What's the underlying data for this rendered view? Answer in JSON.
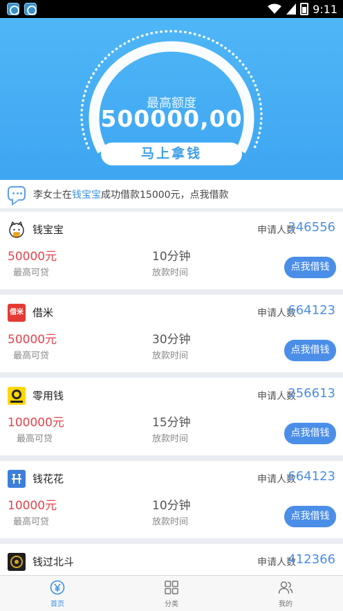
{
  "status_bar": {
    "time": "9:11",
    "app_icons": [
      "app-icon",
      "app-icon"
    ],
    "icons": [
      "wifi-icon",
      "signal-icon",
      "battery-icon"
    ]
  },
  "hero": {
    "label": "最高额度",
    "amount": "500000,00",
    "button": "马上拿钱",
    "gauge_icon": "dotted-arc"
  },
  "notice": {
    "icon": "chat-bubble-icon",
    "prefix": "李女士在",
    "highlight": "钱宝宝",
    "suffix": "成功借款15000元，点我借款"
  },
  "colors": {
    "accent": "#4a8ee8",
    "amount_red": "#e8424b",
    "hero_blue": "#3ea6f2"
  },
  "products": [
    {
      "name": "钱宝宝",
      "logo_icon": "cat-logo-icon",
      "apply_label": "申请人数",
      "apply_count": "346556",
      "amount": "50000元",
      "amount_label": "最高可贷",
      "time": "10分钟",
      "time_label": "放款时间",
      "button": "点我借钱"
    },
    {
      "name": "借米",
      "logo_icon": "jiemi-logo-icon",
      "logo_text": "借米",
      "apply_label": "申请人数",
      "apply_count": "664123",
      "amount": "50000元",
      "amount_label": "最高可贷",
      "time": "30分钟",
      "time_label": "放款时间",
      "button": "点我借钱"
    },
    {
      "name": "零用钱",
      "logo_icon": "lingyongqian-logo-icon",
      "apply_label": "申请人数",
      "apply_count": "256613",
      "amount": "100000元",
      "amount_label": "最高可贷",
      "time": "15分钟",
      "time_label": "放款时间",
      "button": "点我借钱"
    },
    {
      "name": "钱花花",
      "logo_icon": "qianhuahua-logo-icon",
      "apply_label": "申请人数",
      "apply_count": "664123",
      "amount": "10000元",
      "amount_label": "最高可贷",
      "time": "10分钟",
      "time_label": "放款时间",
      "button": "点我借钱"
    },
    {
      "name": "钱过北斗",
      "logo_icon": "beidou-logo-icon",
      "apply_label": "申请人数",
      "apply_count": "412366"
    }
  ],
  "tabs": [
    {
      "label": "首页",
      "icon": "yuan-circle-icon",
      "active": true
    },
    {
      "label": "分类",
      "icon": "grid-icon",
      "active": false
    },
    {
      "label": "我的",
      "icon": "users-icon",
      "active": false
    }
  ]
}
